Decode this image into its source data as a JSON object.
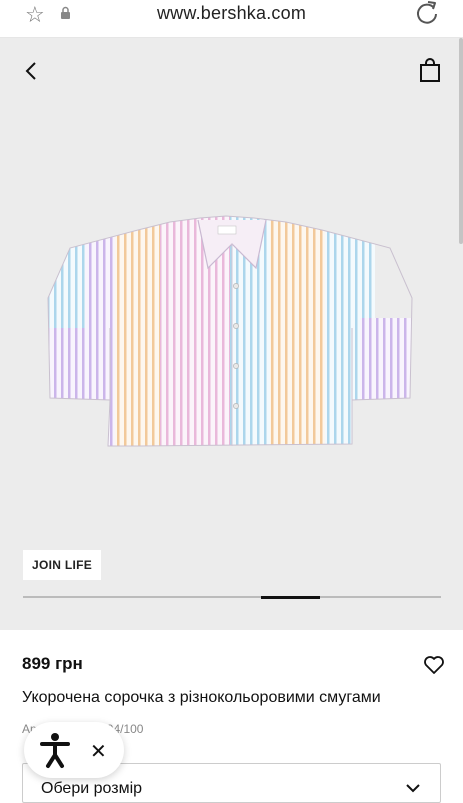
{
  "browser": {
    "url": "www.bershka.com",
    "star_icon": "star-icon",
    "lock_icon": "lock-icon",
    "reload_icon": "reload-icon"
  },
  "gallery": {
    "back_icon": "chevron-left-icon",
    "bag_icon": "shopping-bag-icon",
    "badge": "JOIN LIFE",
    "progress": 0.14,
    "progress_start": 0.57,
    "stripe_colors": [
      "#f2b7d9",
      "#a9d9ef",
      "#f7cd9a",
      "#cfb7ee"
    ]
  },
  "product": {
    "price": "899 грн",
    "title": "Укорочена сорочка з різнокольоровими смугами",
    "article": "Артикул 1078/494/100",
    "size_select": "Обери розмір",
    "wishlist_icon": "heart-icon"
  },
  "accessibility": {
    "icon": "accessibility-icon",
    "close": "✕"
  }
}
